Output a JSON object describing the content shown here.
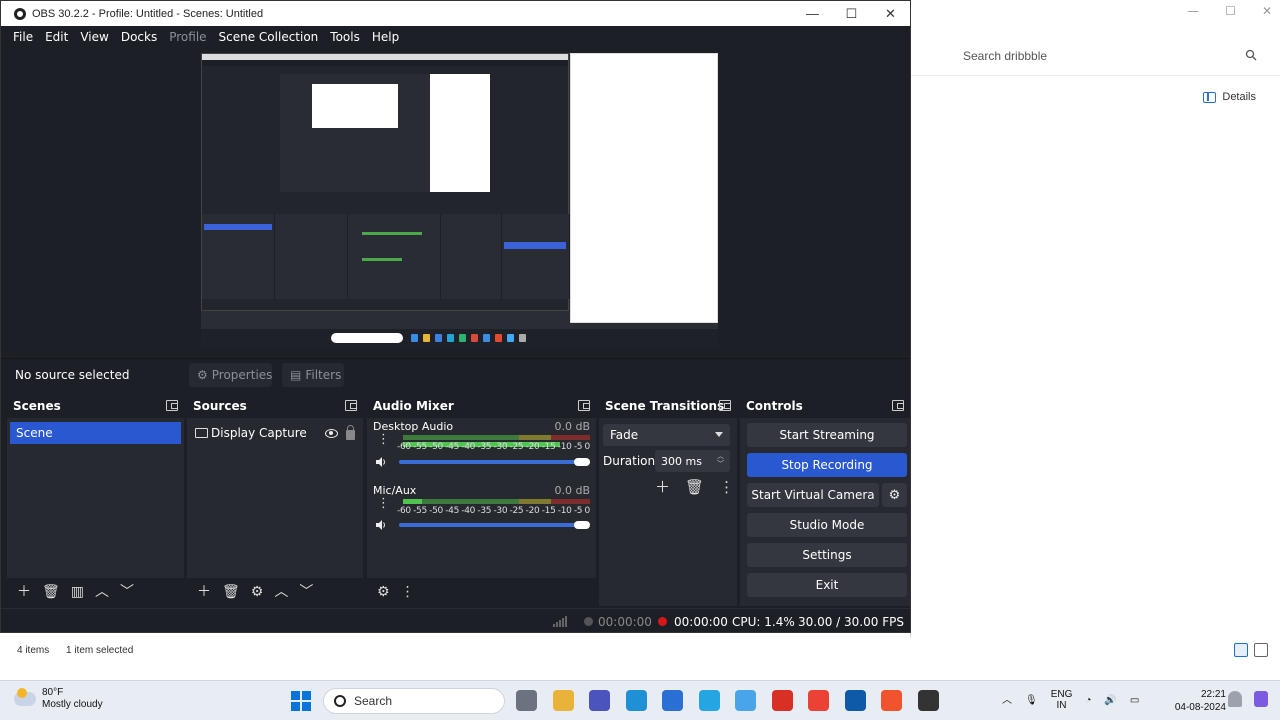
{
  "obs": {
    "title": "OBS 30.2.2 - Profile: Untitled - Scenes: Untitled",
    "window_controls": {
      "minimize": "—",
      "maximize": "☐",
      "close": "✕"
    },
    "menu": [
      {
        "label": "File",
        "disabled": false
      },
      {
        "label": "Edit",
        "disabled": false
      },
      {
        "label": "View",
        "disabled": false
      },
      {
        "label": "Docks",
        "disabled": false
      },
      {
        "label": "Profile",
        "disabled": true
      },
      {
        "label": "Scene Collection",
        "disabled": false
      },
      {
        "label": "Tools",
        "disabled": false
      },
      {
        "label": "Help",
        "disabled": false
      }
    ],
    "source_bar": {
      "status": "No source selected",
      "properties_label": "Properties",
      "filters_label": "Filters"
    },
    "docks": {
      "scenes": {
        "title": "Scenes",
        "items": [
          "Scene"
        ]
      },
      "sources": {
        "title": "Sources",
        "items": [
          "Display Capture"
        ]
      },
      "audio_mixer": {
        "title": "Audio Mixer",
        "channels": [
          {
            "name": "Desktop Audio",
            "db": "0.0 dB",
            "level": 0.84
          },
          {
            "name": "Mic/Aux",
            "db": "0.0 dB",
            "level": 0.1
          }
        ],
        "ticks": [
          "-60",
          "-55",
          "-50",
          "-45",
          "-40",
          "-35",
          "-30",
          "-25",
          "-20",
          "-15",
          "-10",
          "-5",
          "0"
        ]
      },
      "scene_transitions": {
        "title": "Scene Transitions",
        "transition": "Fade",
        "duration_label": "Duration",
        "duration_value": "300 ms"
      },
      "controls": {
        "title": "Controls",
        "buttons": {
          "start_streaming": "Start Streaming",
          "stop_recording": "Stop Recording",
          "start_virtual_camera": "Start Virtual Camera",
          "studio_mode": "Studio Mode",
          "settings": "Settings",
          "exit": "Exit"
        }
      }
    },
    "status": {
      "stream_time": "00:00:00",
      "record_time": "00:00:00",
      "cpu": "CPU: 1.4%",
      "fps": "30.00 / 30.00 FPS"
    }
  },
  "browser": {
    "search_placeholder": "Search dribbble",
    "details_label": "Details"
  },
  "explorer_status": {
    "items": "4 items",
    "selected": "1 item selected"
  },
  "taskbar": {
    "weather_temp": "80°F",
    "weather_desc": "Mostly cloudy",
    "search_label": "Search",
    "lang_line1": "ENG",
    "lang_line2": "IN",
    "time": "22:21",
    "date": "04-08-2024"
  },
  "colors": {
    "obs_bg": "#1d1f26",
    "dock_bg": "#272930",
    "accent_blue": "#2958d1",
    "recording_red": "#d9161c"
  }
}
